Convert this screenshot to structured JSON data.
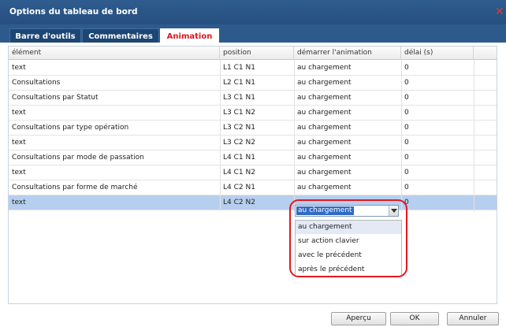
{
  "window": {
    "title": "Options du tableau de bord",
    "close_glyph": "✕"
  },
  "tabs": [
    {
      "label": "Barre d'outils",
      "active": false
    },
    {
      "label": "Commentaires",
      "active": false
    },
    {
      "label": "Animation",
      "active": true
    }
  ],
  "grid": {
    "columns": [
      "élément",
      "position",
      "démarrer l'animation",
      "délai (s)"
    ],
    "rows": [
      {
        "element": "text",
        "position": "L1 C1 N1",
        "start": "au chargement",
        "delay": "0"
      },
      {
        "element": "Consultations",
        "position": "L2 C1 N1",
        "start": "au chargement",
        "delay": "0"
      },
      {
        "element": "Consultations par Statut",
        "position": "L3 C1 N1",
        "start": "au chargement",
        "delay": "0"
      },
      {
        "element": "text",
        "position": "L3 C1 N2",
        "start": "au chargement",
        "delay": "0"
      },
      {
        "element": "Consultations par type opération",
        "position": "L3 C2 N1",
        "start": "au chargement",
        "delay": "0"
      },
      {
        "element": "text",
        "position": "L3 C2 N2",
        "start": "au chargement",
        "delay": "0"
      },
      {
        "element": "Consultations par mode de passation",
        "position": "L4 C1 N1",
        "start": "au chargement",
        "delay": "0"
      },
      {
        "element": "text",
        "position": "L4 C1 N2",
        "start": "au chargement",
        "delay": "0"
      },
      {
        "element": "Consultations par forme de marché",
        "position": "L4 C2 N1",
        "start": "au chargement",
        "delay": "0"
      },
      {
        "element": "text",
        "position": "L4 C2 N2",
        "start": "",
        "delay": "0"
      }
    ],
    "selected_row": 9
  },
  "editor": {
    "selected_value": "au chargement",
    "options": [
      "au chargement",
      "sur action clavier",
      "avec le précédent",
      "après le précédent"
    ],
    "highlighted_option": 0
  },
  "buttons": {
    "preview": "Aperçu",
    "ok": "OK",
    "cancel": "Annuler"
  },
  "colors": {
    "titlebar": "#2f5c8f",
    "active_tab_text": "#d8191f",
    "selected_row": "#b7cfee",
    "annotation": "#e3181f"
  }
}
